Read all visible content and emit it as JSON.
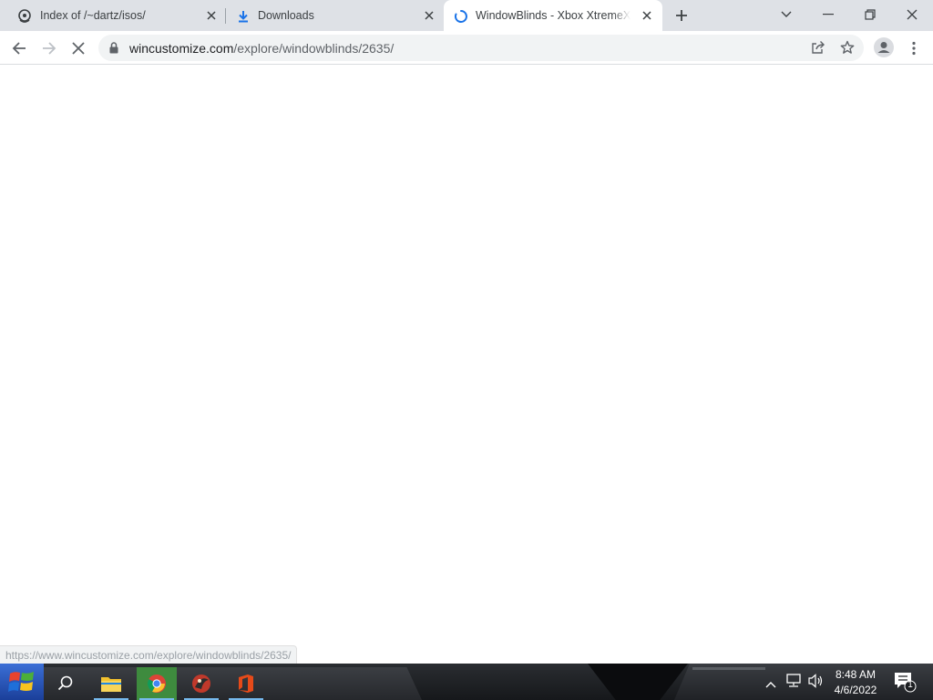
{
  "tabs": [
    {
      "title": "Index of /~dartz/isos/",
      "icon": "site-icon"
    },
    {
      "title": "Downloads",
      "icon": "download-icon"
    },
    {
      "title": "WindowBlinds - Xbox XtremeXP",
      "icon": "loading-spinner-icon",
      "active": true
    }
  ],
  "toolbar": {
    "url_host": "wincustomize.com",
    "url_path": "/explore/windowblinds/2635/"
  },
  "status_bar": {
    "link": "https://www.wincustomize.com/explore/windowblinds/2635/"
  },
  "taskbar": {
    "time": "8:48 AM",
    "date": "4/6/2022",
    "notification_count": "1"
  },
  "colors": {
    "tabstrip": "#dee1e6",
    "active_tab": "#ffffff",
    "spinner": "#1a73e8",
    "taskbar": "#1c1e21"
  }
}
